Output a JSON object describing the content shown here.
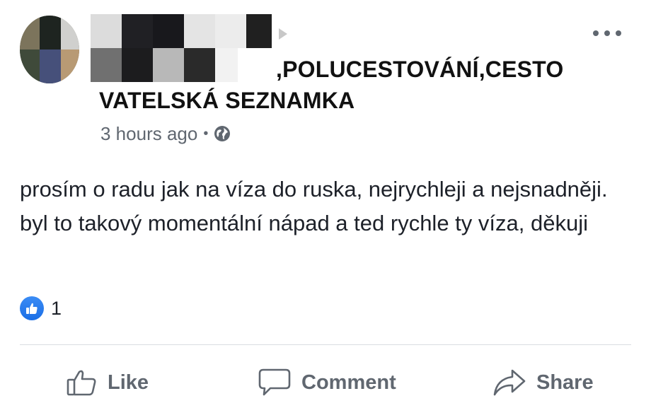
{
  "post": {
    "author_censored": "",
    "group_name_line1": "POLUCESTOVÁNÍ,CESTO",
    "group_name_line1_prefix": ",",
    "group_name_line2": "VATELSKÁ SEZNAMKA",
    "timestamp": "3 hours ago",
    "separator": "•",
    "privacy_icon": "globe-icon",
    "body": "prosím o radu jak na víza do ruska, nejrychleji a nejsnadněji. byl to takový momentální nápad a ted rychle ty víza, děkuji",
    "reactions": {
      "icon": "like-reaction-icon",
      "count": "1"
    }
  },
  "actions": {
    "like_label": "Like",
    "comment_label": "Comment",
    "share_label": "Share"
  },
  "colors": {
    "text_primary": "#1d2129",
    "text_secondary": "#606770",
    "like_blue": "#1a6ee6",
    "divider": "#dadde1"
  }
}
